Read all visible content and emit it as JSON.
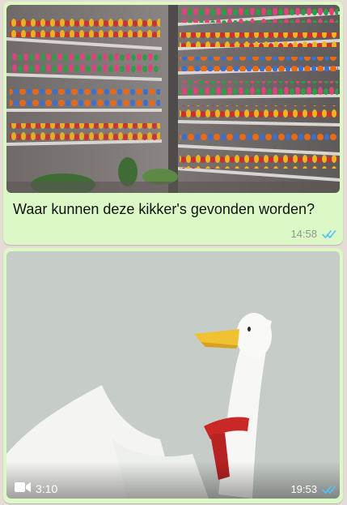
{
  "messages": [
    {
      "type": "image",
      "image_alt": "Shop shelves filled with colorful ceramic frog figurines",
      "caption": "Waar kunnen deze kikker's gevonden worden?",
      "time": "14:58",
      "status": "read"
    },
    {
      "type": "video",
      "thumbnail_alt": "Cartoon white goose with yellow beak and red scarf",
      "duration": "3:10",
      "time": "19:53",
      "status": "read"
    }
  ],
  "colors": {
    "chat_background": "#e5ddd5",
    "outgoing_bubble": "#dcf8c6",
    "read_ticks": "#4fc3f7"
  },
  "icons": {
    "video": "video-camera-icon",
    "status": "double-check-icon"
  }
}
